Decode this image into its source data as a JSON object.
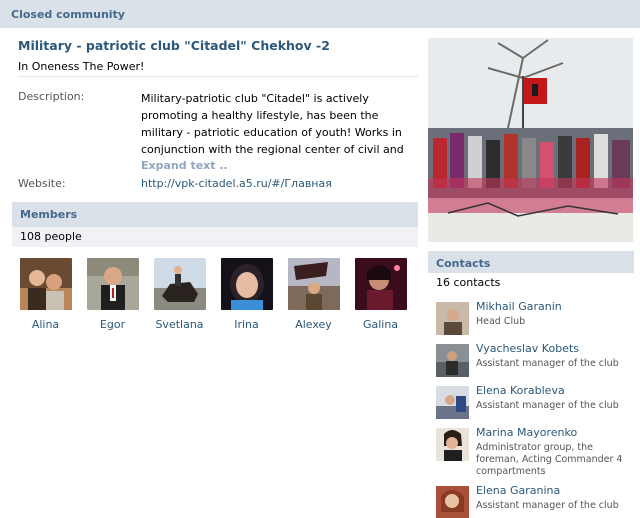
{
  "header": {
    "title": "Closed community"
  },
  "group": {
    "name": "Military - patriotic club \"Citadel\" Chekhov -2",
    "status": "In Oneness The Power!",
    "description_label": "Description:",
    "description": "Military-patriotic club \"Citadel\" is actively promoting a healthy lifestyle, has been the military - patriotic education of youth! Works in conjunction with the regional center of civil and patriotic education \"feat\",",
    "expand_label": "Expand text ..",
    "website_label": "Website:",
    "website": "http://vpk-citadel.a5.ru/#/Главная"
  },
  "members": {
    "title": "Members",
    "count": "108 people",
    "items": [
      {
        "name": "Alina",
        "icon": "member-photo"
      },
      {
        "name": "Egor",
        "icon": "member-photo"
      },
      {
        "name": "Svetlana",
        "icon": "member-photo"
      },
      {
        "name": "Irina",
        "icon": "member-photo"
      },
      {
        "name": "Alexey",
        "icon": "member-photo"
      },
      {
        "name": "Galina",
        "icon": "member-photo"
      }
    ]
  },
  "contacts": {
    "title": "Contacts",
    "count": "16 contacts",
    "items": [
      {
        "name": "Mikhail Garanin",
        "role": "Head Club"
      },
      {
        "name": "Vyacheslav Kobets",
        "role": "Assistant manager of the club"
      },
      {
        "name": "Elena Korableva",
        "role": "Assistant manager of the club"
      },
      {
        "name": "Marina Mayorenko",
        "role": "Administrator group, the foreman, Acting Commander 4 compartments"
      },
      {
        "name": "Elena Garanina",
        "role": "Assistant manager of the club"
      }
    ]
  },
  "colors": {
    "header_bg": "#dae1e8",
    "link": "#2b587a",
    "section_title": "#45688e",
    "expand": "#8ea6be"
  }
}
